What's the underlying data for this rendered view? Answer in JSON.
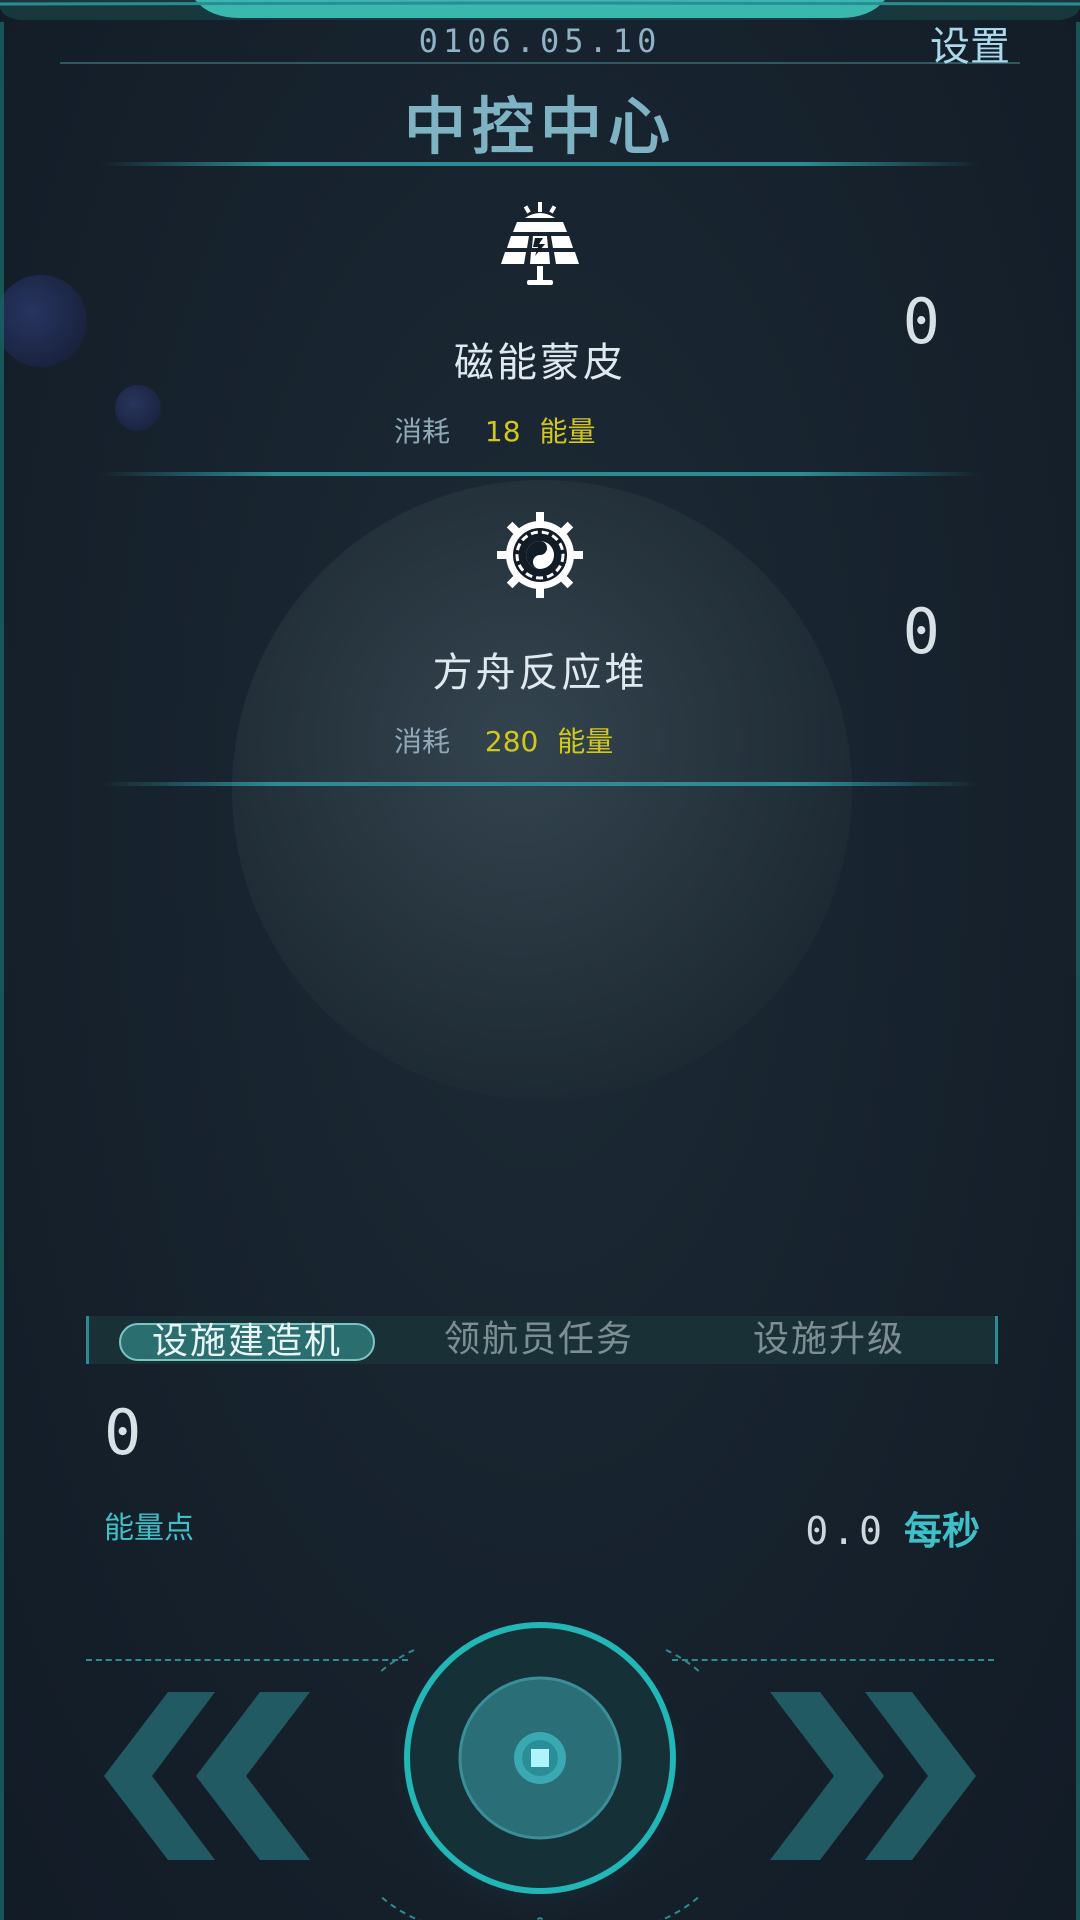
{
  "header": {
    "date": "0106.05.10",
    "settings_label": "设置",
    "title": "中控中心"
  },
  "facilities": [
    {
      "name": "磁能蒙皮",
      "icon": "solar-panel-icon",
      "cost_label": "消耗",
      "cost_value": "18",
      "cost_unit": "能量",
      "count": "0"
    },
    {
      "name": "方舟反应堆",
      "icon": "reactor-gear-icon",
      "cost_label": "消耗",
      "cost_value": "280",
      "cost_unit": "能量",
      "count": "0"
    }
  ],
  "tabs": [
    {
      "label": "设施建造机",
      "active": true
    },
    {
      "label": "领航员任务",
      "active": false
    },
    {
      "label": "设施升级",
      "active": false
    }
  ],
  "energy": {
    "value": "0",
    "label": "能量点",
    "rate": "0.0",
    "rate_unit": "每秒"
  },
  "colors": {
    "accent": "#2b8c93",
    "cost_yellow": "#d2c81a",
    "cyan_text": "#3fc0c8",
    "background": "#121c27"
  },
  "controls": {
    "left_icon": "double-chevron-left-icon",
    "center_icon": "core-button-icon",
    "right_icon": "double-chevron-right-icon"
  }
}
